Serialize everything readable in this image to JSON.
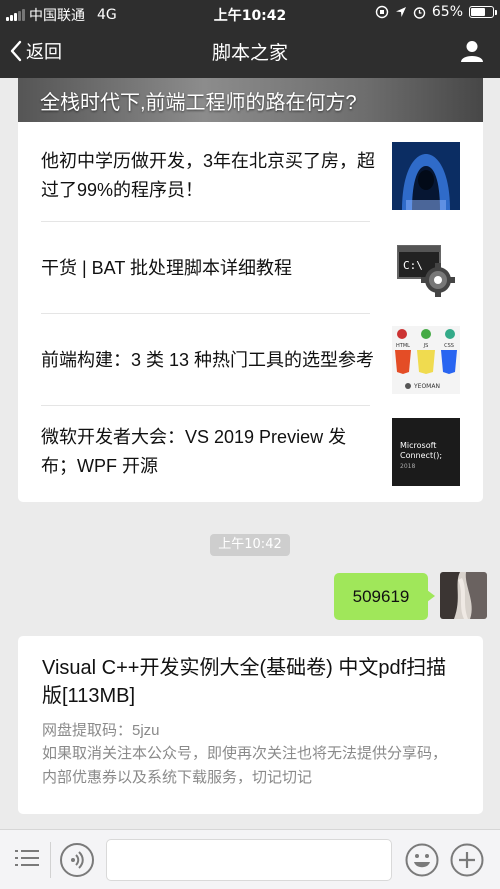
{
  "status_bar": {
    "carrier": "中国联通",
    "network": "4G",
    "time": "上午10:42",
    "battery": "65%",
    "battery_level": 0.65
  },
  "nav": {
    "back_label": "返回",
    "title": "脚本之家"
  },
  "article_card": {
    "cover_title": "全栈时代下,前端工程师的路在何方?",
    "items": [
      {
        "title": "他初中学历做开发，3年在北京买了房，超过了99%的程序员！",
        "thumb": "hacker-hoodie"
      },
      {
        "title": "干货 | BAT 批处理脚本详细教程",
        "thumb": "cmd-gear"
      },
      {
        "title": "前端构建：3 类 13 种热门工具的选型参考",
        "thumb": "html5-js-css3-logos"
      },
      {
        "title": "微软开发者大会：VS 2019 Preview 发布；WPF 开源",
        "thumb": "microsoft-connect"
      }
    ]
  },
  "thumbs": {
    "cmd": "C:\\",
    "html": "HTML",
    "js": "JS",
    "css": "CSS",
    "yeoman": "YEOMAN",
    "ms_line1": "Microsoft",
    "ms_line2": "Connect();",
    "ms_line3": "2018"
  },
  "chat": {
    "timestamp": "上午10:42",
    "message": "509619"
  },
  "info_card": {
    "title": "Visual C++开发实例大全(基础卷) 中文pdf扫描版[113MB]",
    "code_line": "网盘提取码：5jzu",
    "note": "如果取消关注本公众号，即使再次关注也将无法提供分享码，内部优惠券以及系统下载服务，切记切记"
  },
  "input_bar": {
    "text_value": ""
  },
  "colors": {
    "header_bg": "#2e2e2e",
    "chat_bg": "#ebebeb",
    "bubble_green": "#a0e75a"
  }
}
